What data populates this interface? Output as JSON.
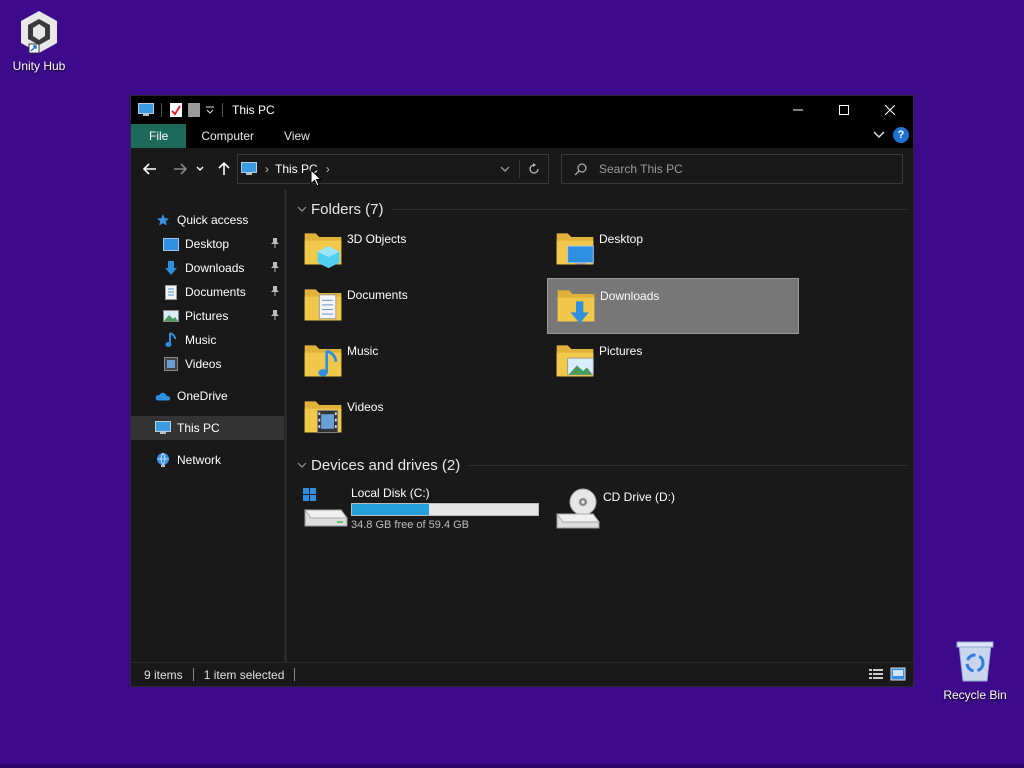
{
  "desktop": {
    "icons": [
      {
        "label": "Unity Hub"
      },
      {
        "label": "Recycle Bin"
      }
    ]
  },
  "window": {
    "title": "This PC",
    "ribbon_tabs": [
      "File",
      "Computer",
      "View"
    ],
    "address": {
      "location": "This PC",
      "separator": "›"
    },
    "search": {
      "placeholder": "Search This PC"
    }
  },
  "sidebar": {
    "quick_access": "Quick access",
    "pinned": [
      {
        "label": "Desktop",
        "icon": "desktop-icon"
      },
      {
        "label": "Downloads",
        "icon": "download-icon"
      },
      {
        "label": "Documents",
        "icon": "document-icon"
      },
      {
        "label": "Pictures",
        "icon": "picture-icon"
      }
    ],
    "unpinned": [
      {
        "label": "Music",
        "icon": "music-icon"
      },
      {
        "label": "Videos",
        "icon": "video-icon"
      }
    ],
    "onedrive": "OneDrive",
    "this_pc": "This PC",
    "network": "Network"
  },
  "content": {
    "folders_header": "Folders (7)",
    "folders": [
      {
        "name": "3D Objects",
        "overlay": "cube"
      },
      {
        "name": "Desktop",
        "overlay": "monitor"
      },
      {
        "name": "Documents",
        "overlay": "doc"
      },
      {
        "name": "Downloads",
        "overlay": "arrow",
        "selected": true
      },
      {
        "name": "Music",
        "overlay": "note"
      },
      {
        "name": "Pictures",
        "overlay": "photo"
      },
      {
        "name": "Videos",
        "overlay": "film"
      }
    ],
    "drives_header": "Devices and drives (2)",
    "drives": [
      {
        "name": "Local Disk (C:)",
        "free_text": "34.8 GB free of 59.4 GB",
        "used_fraction": 0.414
      },
      {
        "name": "CD Drive (D:)"
      }
    ]
  },
  "status": {
    "items": "9 items",
    "selected": "1 item selected"
  },
  "colors": {
    "desktop_bg": "#3d0a8c",
    "file_tab": "#1d6a5b",
    "drive_bar": "#26a0da",
    "folder": "#f2c84b"
  }
}
